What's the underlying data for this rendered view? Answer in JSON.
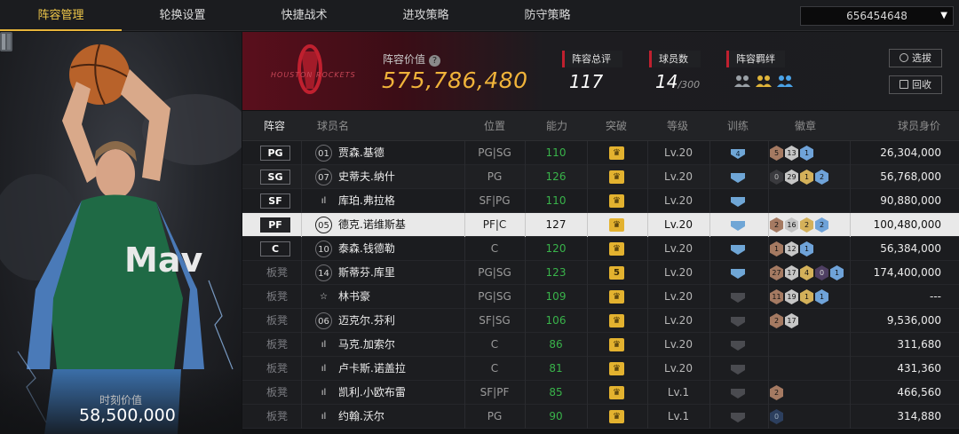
{
  "nav": {
    "tabs": [
      "阵容管理",
      "轮换设置",
      "快捷战术",
      "进攻策略",
      "防守策略"
    ],
    "active_tab": 0,
    "team_select_value": "656454648"
  },
  "hero": {
    "moment_label": "时刻价值",
    "moment_value": "58,500,000",
    "jersey_text": "Mav"
  },
  "header": {
    "team_logo_text": "HOUSTON ROCKETS",
    "value_label": "阵容价值",
    "value_number": "575,786,480",
    "rating_label": "阵容总评",
    "rating_value": "117",
    "count_label": "球员数",
    "count_value": "14",
    "count_max": "/300",
    "bond_label": "阵容羁绊",
    "select_button": "选拔",
    "recycle_button": "回收"
  },
  "table": {
    "headers": [
      "阵容",
      "球员名",
      "位置",
      "能力",
      "突破",
      "等级",
      "训练",
      "徽章",
      "球员身价"
    ],
    "rows": [
      {
        "slot": "PG",
        "num": "01",
        "name": "贾森.基德",
        "pos": "PG|SG",
        "ability": "110",
        "break": "crown",
        "level": "Lv.20",
        "train": "4",
        "badges": [
          [
            "bronze",
            "5"
          ],
          [
            "silver",
            "13"
          ],
          [
            "blue",
            "1"
          ]
        ],
        "value": "26,304,000"
      },
      {
        "slot": "SG",
        "num": "07",
        "name": "史蒂夫.纳什",
        "pos": "PG",
        "ability": "126",
        "break": "crown",
        "level": "Lv.20",
        "train": "",
        "badges": [
          [
            "dark",
            "0"
          ],
          [
            "silver",
            "29"
          ],
          [
            "gold",
            "1"
          ],
          [
            "blue",
            "2"
          ]
        ],
        "value": "56,768,000"
      },
      {
        "slot": "SF",
        "num": "ıl",
        "name": "库珀.弗拉格",
        "pos": "SF|PG",
        "ability": "110",
        "break": "crown",
        "level": "Lv.20",
        "train": "",
        "badges": [],
        "value": "90,880,000"
      },
      {
        "slot": "PF",
        "num": "05",
        "name": "德克.诺维斯基",
        "pos": "PF|C",
        "ability": "127",
        "break": "crown",
        "level": "Lv.20",
        "train": "",
        "badges": [
          [
            "bronze",
            "2"
          ],
          [
            "silver",
            "16"
          ],
          [
            "gold",
            "2"
          ],
          [
            "blue",
            "2"
          ]
        ],
        "value": "100,480,000"
      },
      {
        "slot": "C",
        "num": "10",
        "name": "泰森.钱德勒",
        "pos": "C",
        "ability": "120",
        "break": "crown",
        "level": "Lv.20",
        "train": "",
        "badges": [
          [
            "bronze",
            "1"
          ],
          [
            "silver",
            "12"
          ],
          [
            "blue",
            "1"
          ]
        ],
        "value": "56,384,000"
      },
      {
        "slot": "板凳",
        "num": "14",
        "name": "斯蒂芬.库里",
        "pos": "PG|SG",
        "ability": "123",
        "break": "5",
        "level": "Lv.20",
        "train": "",
        "badges": [
          [
            "bronze",
            "27"
          ],
          [
            "silver",
            "17"
          ],
          [
            "gold",
            "4"
          ],
          [
            "purple",
            "0"
          ],
          [
            "blue",
            "1"
          ]
        ],
        "value": "174,400,000"
      },
      {
        "slot": "板凳",
        "num": "☆",
        "name": "林书豪",
        "pos": "PG|SG",
        "ability": "109",
        "break": "crown",
        "level": "Lv.20",
        "train": "",
        "badges": [
          [
            "bronze",
            "11"
          ],
          [
            "silver",
            "19"
          ],
          [
            "gold",
            "1"
          ],
          [
            "blue",
            "1"
          ]
        ],
        "value": "---"
      },
      {
        "slot": "板凳",
        "num": "06",
        "name": "迈克尔.芬利",
        "pos": "SF|SG",
        "ability": "106",
        "break": "crown",
        "level": "Lv.20",
        "train": "",
        "badges": [
          [
            "bronze",
            "2"
          ],
          [
            "silver",
            "17"
          ]
        ],
        "value": "9,536,000"
      },
      {
        "slot": "板凳",
        "num": "ıl",
        "name": "马克.加索尔",
        "pos": "C",
        "ability": "86",
        "break": "crown",
        "level": "Lv.20",
        "train": "",
        "badges": [],
        "value": "311,680"
      },
      {
        "slot": "板凳",
        "num": "ıl",
        "name": "卢卡斯.诺盖拉",
        "pos": "C",
        "ability": "81",
        "break": "crown",
        "level": "Lv.20",
        "train": "",
        "badges": [],
        "value": "431,360"
      },
      {
        "slot": "板凳",
        "num": "ıl",
        "name": "凯利.小欧布雷",
        "pos": "SF|PF",
        "ability": "85",
        "break": "crown",
        "level": "Lv.1",
        "train": "",
        "badges": [
          [
            "bronze",
            "2"
          ]
        ],
        "value": "466,560"
      },
      {
        "slot": "板凳",
        "num": "ıl",
        "name": "约翰.沃尔",
        "pos": "PG",
        "ability": "90",
        "break": "crown",
        "level": "Lv.1",
        "train": "",
        "badges": [
          [
            "navy",
            "0"
          ]
        ],
        "value": "314,880"
      }
    ]
  },
  "colors": {
    "accent_gold": "#f0b33a",
    "rockets_red": "#c0202f",
    "ability_green": "#39b34a"
  }
}
